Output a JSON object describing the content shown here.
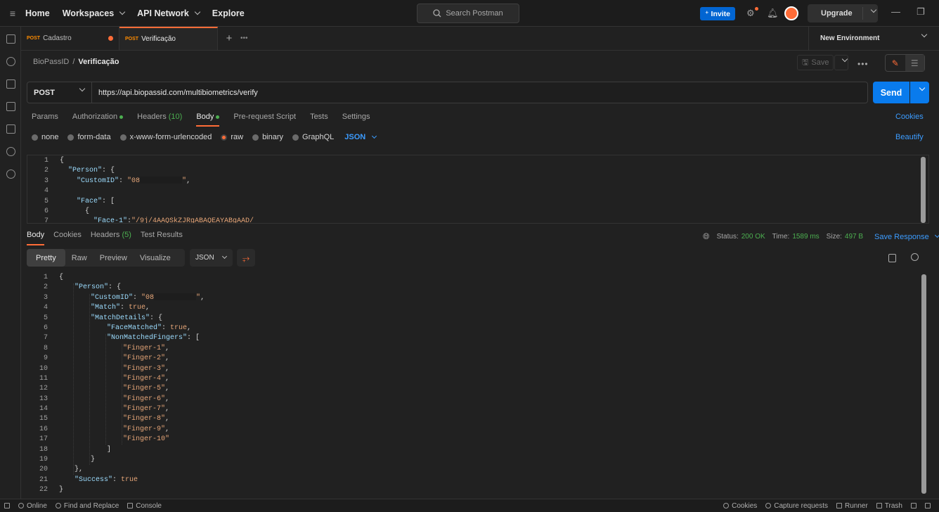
{
  "topbar": {
    "nav": [
      "Home",
      "Workspaces",
      "API Network",
      "Explore"
    ],
    "search_placeholder": "Search Postman",
    "invite": "Invite",
    "upgrade": "Upgrade"
  },
  "tabs": [
    {
      "method": "POST",
      "name": "Cadastro",
      "unsaved": true
    },
    {
      "method": "POST",
      "name": "Verificação",
      "active": true
    }
  ],
  "environment": "New Environment",
  "breadcrumb": {
    "collection": "BioPassID",
    "request": "Verificação"
  },
  "save_label": "Save",
  "request": {
    "method": "POST",
    "url": "https://api.biopassid.com/multibiometrics/verify",
    "send": "Send",
    "tabs": {
      "params": "Params",
      "authorization": "Authorization",
      "headers": "Headers",
      "headers_count": "(10)",
      "body": "Body",
      "prerequest": "Pre-request Script",
      "tests": "Tests",
      "settings": "Settings"
    },
    "cookies": "Cookies",
    "body_types": [
      "none",
      "form-data",
      "x-www-form-urlencoded",
      "raw",
      "binary",
      "GraphQL"
    ],
    "body_format": "JSON",
    "beautify": "Beautify",
    "body_lines": [
      {
        "n": "1",
        "t": "{"
      },
      {
        "n": "2",
        "t": "  \"Person\": {"
      },
      {
        "n": "3",
        "t": "    \"CustomID\": \"08"
      },
      {
        "n": "4",
        "t": ""
      },
      {
        "n": "5",
        "t": "    \"Face\": ["
      },
      {
        "n": "6",
        "t": "      {"
      },
      {
        "n": "7",
        "t": "        \"Face-1\":\"/9j/4AAQSkZJRgABAQEAYABgAAD/"
      }
    ]
  },
  "response": {
    "tabs": {
      "body": "Body",
      "cookies": "Cookies",
      "headers": "Headers",
      "headers_count": "(5)",
      "tests": "Test Results"
    },
    "status_label": "Status:",
    "status": "200 OK",
    "time_label": "Time:",
    "time": "1589 ms",
    "size_label": "Size:",
    "size": "497 B",
    "save_response": "Save Response",
    "views": [
      "Pretty",
      "Raw",
      "Preview",
      "Visualize"
    ],
    "format": "JSON",
    "lines": [
      {
        "n": "1",
        "t": "{"
      },
      {
        "n": "2",
        "t": "    \"Person\": {"
      },
      {
        "n": "3",
        "t": "        \"CustomID\": \"08"
      },
      {
        "n": "4",
        "t": "        \"Match\": true,"
      },
      {
        "n": "5",
        "t": "        \"MatchDetails\": {"
      },
      {
        "n": "6",
        "t": "            \"FaceMatched\": true,"
      },
      {
        "n": "7",
        "t": "            \"NonMatchedFingers\": ["
      },
      {
        "n": "8",
        "t": "                \"Finger-1\","
      },
      {
        "n": "9",
        "t": "                \"Finger-2\","
      },
      {
        "n": "10",
        "t": "                \"Finger-3\","
      },
      {
        "n": "11",
        "t": "                \"Finger-4\","
      },
      {
        "n": "12",
        "t": "                \"Finger-5\","
      },
      {
        "n": "13",
        "t": "                \"Finger-6\","
      },
      {
        "n": "14",
        "t": "                \"Finger-7\","
      },
      {
        "n": "15",
        "t": "                \"Finger-8\","
      },
      {
        "n": "16",
        "t": "                \"Finger-9\","
      },
      {
        "n": "17",
        "t": "                \"Finger-10\""
      },
      {
        "n": "18",
        "t": "            ]"
      },
      {
        "n": "19",
        "t": "        }"
      },
      {
        "n": "20",
        "t": "    },"
      },
      {
        "n": "21",
        "t": "    \"Success\": true"
      },
      {
        "n": "22",
        "t": "}"
      }
    ]
  },
  "statusbar": [
    "Online",
    "Find and Replace",
    "Console",
    "Cookies",
    "Capture requests",
    "Runner",
    "Trash"
  ],
  "colors": {
    "accent": "#ff6c37",
    "primary": "#097bed",
    "link": "#3c9cff",
    "ok": "#4caf50"
  }
}
